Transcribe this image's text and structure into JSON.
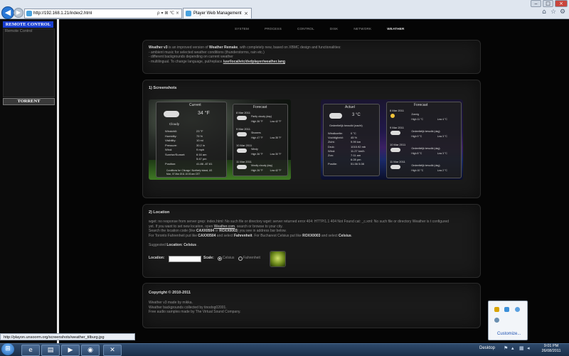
{
  "browser": {
    "address": "http://192.168.1.21/index2.html",
    "tab_title": "Player Web Management",
    "tab_close": "×",
    "back": "◀",
    "forward": "▶",
    "addr_tools": "ρ ▾ ⊠ ℃ ×",
    "icons": {
      "home": "⌂",
      "favorites": "☆",
      "settings": "⚙"
    },
    "window_buttons": {
      "minimize": "‒",
      "maximize": "□",
      "close": "×"
    }
  },
  "sidebar": {
    "remote_control_header": "REMOTE CONTROL",
    "remote_control_link": "Remote Control",
    "torrent_header": "TORRENT"
  },
  "nav": [
    "SYSTEM",
    "PROCESS",
    "CONTROL",
    "DISK",
    "NETWORK",
    "WEATHER"
  ],
  "nav_active": "WEATHER",
  "intro": {
    "line1_prefix": "Weather v3",
    "line1_mid": " is an improved version of ",
    "line1_bold": "Weather Remake",
    "line1_rest": ", with completely new, based on XBMC design and functionalities:",
    "line2": "- ambient music for selected weather conditions (thunderstorms, rain etc.)",
    "line3": "- different backgrounds depending on current weather",
    "line4_prefix": "- multilingual. To change language, put/replace ",
    "line4_link": "/usr/local/etc/dvdplayer/weather.lang",
    "line4_suffix": "."
  },
  "screenshots": {
    "title": "1) Screenshots",
    "shot1": {
      "current_label": "Current",
      "temp": "34 °F",
      "condition": "Cloudy",
      "rows": [
        {
          "label": "Windchill:",
          "value": "23 °F"
        },
        {
          "label": "Humidity:",
          "value": "75 %"
        },
        {
          "label": "Visibility:",
          "value": "10 mi"
        },
        {
          "label": "Pressure:",
          "value": "30.2 in"
        },
        {
          "label": "Wind:",
          "value": "9 mph"
        },
        {
          "label": "Sunrise/Sunset:",
          "value": "6:16 am"
        },
        {
          "label": "",
          "value": "5:47 pm"
        },
        {
          "label": "Position:",
          "value": "41.86  -87.61"
        }
      ],
      "footer": "Conditions for: Chicago / Northerly Island, US",
      "footer2": "Mon, 07 Mar 2011 10:00 am CST",
      "forecast_label": "Forecast",
      "days": [
        {
          "date": "8 Mar 2011",
          "cond": "Partly cloudy (day)",
          "hi": "High  36 °F",
          "lo": "Low  42 °F"
        },
        {
          "date": "9 Mar 2011",
          "cond": "Showers",
          "hi": "High  47 °F",
          "lo": "Low  35 °F"
        },
        {
          "date": "10 Mar 2011",
          "cond": "Windy",
          "hi": "High  36 °F",
          "lo": "Low  30 °F"
        },
        {
          "date": "11 Mar 2011",
          "cond": "Mostly cloudy (day)",
          "hi": "High  26 °F",
          "lo": "Low  42 °F"
        }
      ]
    },
    "shot2": {
      "current_label": "Actuel",
      "temp": "3 °C",
      "condition": "Gedeeltelijk bewolkt (nacht)",
      "rows": [
        {
          "label": "Windkoelte:",
          "value": "0 °C"
        },
        {
          "label": "Vochtigheid:",
          "value": "45 %"
        },
        {
          "label": "Zicht:",
          "value": "9.99 km"
        },
        {
          "label": "Druk:",
          "value": "1015.92 mb"
        },
        {
          "label": "Wind:",
          "value": "11.27 km/h"
        },
        {
          "label": "Zon:",
          "value": "7:11 am"
        },
        {
          "label": "",
          "value": "6:28 pm"
        },
        {
          "label": "Positie:",
          "value": "51.56  5.08"
        }
      ],
      "forecast_label": "Forecast",
      "days": [
        {
          "date": "8 Mar 2011",
          "cond": "Zonnig",
          "hi": "High  11 °C",
          "lo": "Low  4 °C"
        },
        {
          "date": "9 Mar 2011",
          "cond": "Gedeeltelijk bewolkt (dag)",
          "hi": "High  9 °C",
          "lo": "Low  3 °C"
        },
        {
          "date": "10 Mar 2011",
          "cond": "Gedeeltelijk bewolkt (dag)",
          "hi": "High  8 °C",
          "lo": "Low  3 °C"
        },
        {
          "date": "11 Mar 2011",
          "cond": "Gedeeltelijk bewolkt (dag)",
          "hi": "High  10 °C",
          "lo": "Low  2 °C"
        }
      ]
    }
  },
  "location": {
    "title": "2) Location",
    "line1": "wget: no response from server grep: index.html: No such file or directory wget: server returned error 404: HTTP/1.1 404 Not Found cat: _c.xml: No such file or directory Weather is t configured",
    "line2_prefix": "yet. If you want to set new location, open ",
    "line2_link": "Weather.com",
    "line2_suffix": ", search or browse to your city.",
    "line3_prefix": "Search the location code (like ",
    "line3_code1": "CAXX0504",
    "line3_mid": " or ",
    "line3_code2": "ROXX0003",
    "line3_suffix": ") you see in address bar below.",
    "line4_a": "For Toronto Fahrenheit put like ",
    "line4_code1": "CAXX0504",
    "line4_b": " and select ",
    "line4_f": "Fahrenheit",
    "line4_c": ". For Bucharest Celsius put like ",
    "line4_code2": "ROXX0003",
    "line4_d": " and select ",
    "line4_cel": "Celsius",
    "line4_e": ".",
    "suggested_prefix": "Suggested ",
    "suggested_bold": "Location: Celsius",
    "suggested_suffix": " .",
    "location_label": "Location:",
    "location_value": "",
    "scale_label": "Scale:",
    "opt_celsius": "Celsius",
    "opt_fahrenheit": "Fahrenheit",
    "selected_scale": "Celsius"
  },
  "copyright": {
    "title": "Copyright © 2010-2011",
    "line1": "Weather v3 made by mikka.",
    "line2": "Weather backgrounds collected by tinodog02001.",
    "line3": "Free audio samples made by The Virtual Sound Company."
  },
  "status_url": "http://playon.unsoorm.org/screenshots/weather_tilburg.jpg",
  "taskbar": {
    "start": "⊞",
    "desktop_label": "Desktop",
    "time": "9:01 PM",
    "date": "26/08/2011",
    "customize": "Customize...",
    "apps": [
      "e",
      "▤",
      "▶",
      "◉",
      "✕"
    ]
  }
}
